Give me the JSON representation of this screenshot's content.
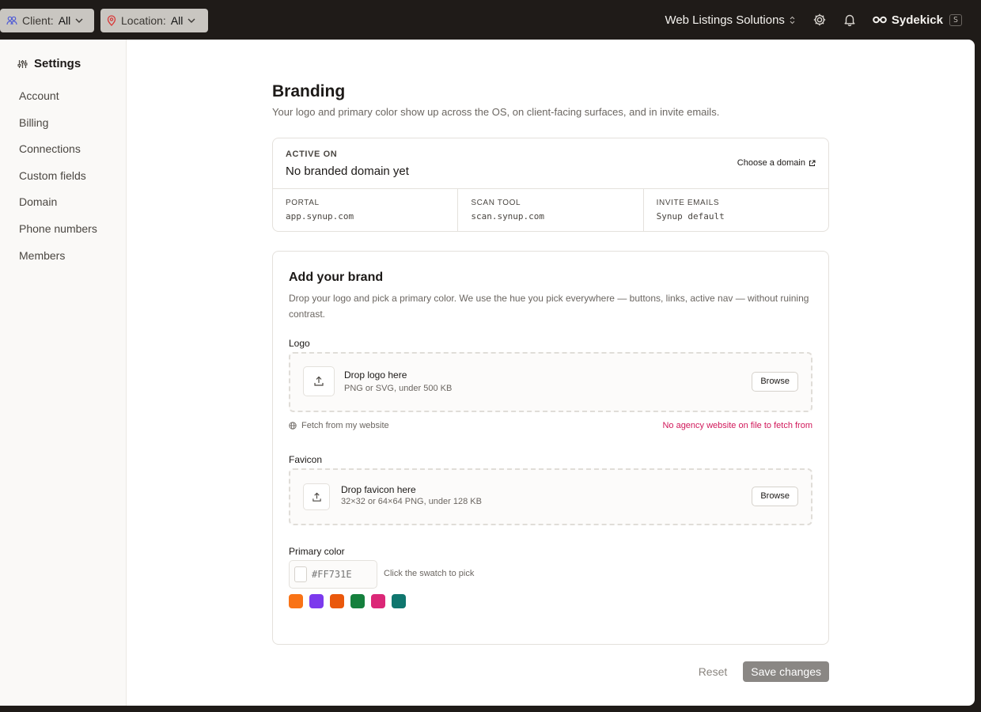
{
  "topbar": {
    "client_filter": {
      "key": "Client:",
      "value": "All"
    },
    "location_filter": {
      "key": "Location:",
      "value": "All"
    },
    "org_name": "Web Listings Solutions",
    "brand_name": "Sydekick",
    "brand_shortcut": "S"
  },
  "sidebar": {
    "title": "Settings",
    "items": [
      {
        "label": "Account"
      },
      {
        "label": "Billing"
      },
      {
        "label": "Connections"
      },
      {
        "label": "Custom fields"
      },
      {
        "label": "Domain"
      },
      {
        "label": "Phone numbers"
      },
      {
        "label": "Members"
      }
    ]
  },
  "page": {
    "title": "Branding",
    "subtitle": "Your logo and primary color show up across the OS, on client-facing surfaces, and in invite emails."
  },
  "active_on": {
    "label": "ACTIVE ON",
    "value": "No branded domain yet",
    "link": "Choose a domain",
    "cells": [
      {
        "label": "PORTAL",
        "value": "app.synup.com"
      },
      {
        "label": "SCAN TOOL",
        "value": "scan.synup.com"
      },
      {
        "label": "INVITE EMAILS",
        "value": "Synup default"
      }
    ]
  },
  "brand": {
    "title": "Add your brand",
    "description": "Drop your logo and pick a primary color. We use the hue you pick everywhere — buttons, links, active nav — without ruining contrast.",
    "logo": {
      "label": "Logo",
      "drop_title": "Drop logo here",
      "drop_hint": "PNG or SVG, under 500 KB",
      "browse": "Browse",
      "fetch": "Fetch from my website",
      "error": "No agency website on file to fetch from"
    },
    "favicon": {
      "label": "Favicon",
      "drop_title": "Drop favicon here",
      "drop_hint": "32×32 or 64×64 PNG, under 128 KB",
      "browse": "Browse"
    },
    "primary_color": {
      "label": "Primary color",
      "value": "",
      "placeholder": "#FF731E",
      "hint": "Click the swatch to pick",
      "swatches": [
        "#f97316",
        "#7c3aed",
        "#ea580c",
        "#15803d",
        "#db2777",
        "#0f766e"
      ]
    }
  },
  "actions": {
    "reset": "Reset",
    "save": "Save changes"
  }
}
